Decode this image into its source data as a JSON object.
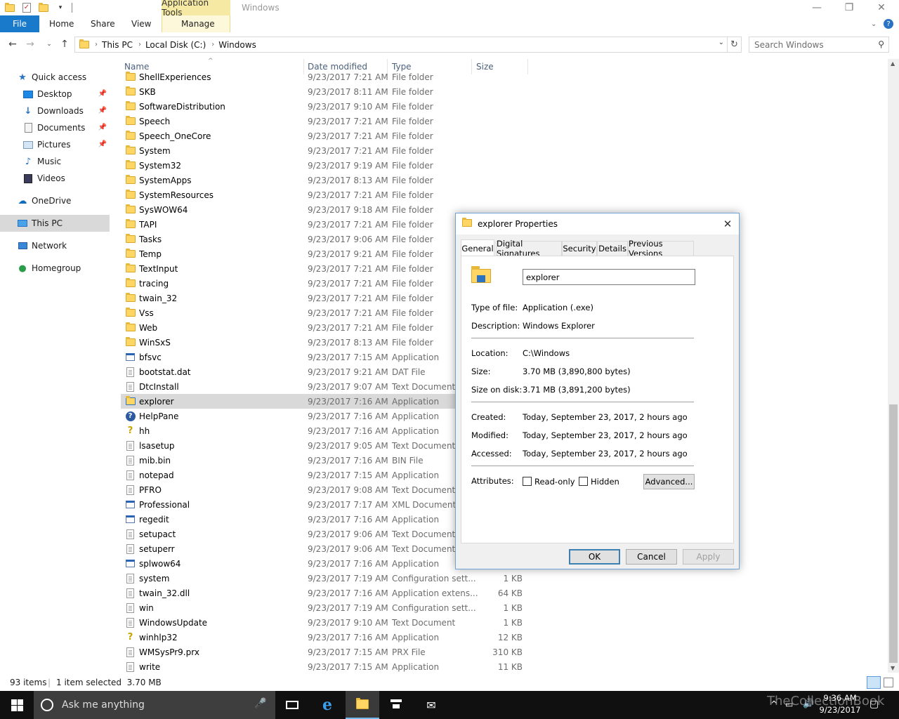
{
  "window": {
    "context_tab": "Application Tools",
    "title": "Windows",
    "controls": {
      "minimize": "—",
      "restore": "❐",
      "close": "✕"
    }
  },
  "ribbon": {
    "file": "File",
    "tabs": [
      "Home",
      "Share",
      "View"
    ],
    "manage": "Manage"
  },
  "address": {
    "segments": [
      "This PC",
      "Local Disk (C:)",
      "Windows"
    ],
    "search_placeholder": "Search Windows"
  },
  "nav": {
    "items": [
      {
        "label": "Quick access",
        "icon": "star-icon"
      },
      {
        "label": "Desktop",
        "icon": "desktop-icon",
        "pinned": true
      },
      {
        "label": "Downloads",
        "icon": "download-icon",
        "pinned": true
      },
      {
        "label": "Documents",
        "icon": "documents-icon",
        "pinned": true
      },
      {
        "label": "Pictures",
        "icon": "pictures-icon",
        "pinned": true
      },
      {
        "label": "Music",
        "icon": "music-icon"
      },
      {
        "label": "Videos",
        "icon": "videos-icon"
      },
      {
        "label": "OneDrive",
        "icon": "cloud-icon"
      },
      {
        "label": "This PC",
        "icon": "computer-icon",
        "selected": true
      },
      {
        "label": "Network",
        "icon": "network-icon"
      },
      {
        "label": "Homegroup",
        "icon": "homegroup-icon"
      }
    ]
  },
  "columns": {
    "name": "Name",
    "date": "Date modified",
    "type": "Type",
    "size": "Size"
  },
  "files": [
    {
      "name": "ShellExperiences",
      "date": "9/23/2017 7:21 AM",
      "type": "File folder",
      "size": "",
      "icon": "folder"
    },
    {
      "name": "SKB",
      "date": "9/23/2017 8:11 AM",
      "type": "File folder",
      "size": "",
      "icon": "folder"
    },
    {
      "name": "SoftwareDistribution",
      "date": "9/23/2017 9:10 AM",
      "type": "File folder",
      "size": "",
      "icon": "folder"
    },
    {
      "name": "Speech",
      "date": "9/23/2017 7:21 AM",
      "type": "File folder",
      "size": "",
      "icon": "folder"
    },
    {
      "name": "Speech_OneCore",
      "date": "9/23/2017 7:21 AM",
      "type": "File folder",
      "size": "",
      "icon": "folder"
    },
    {
      "name": "System",
      "date": "9/23/2017 7:21 AM",
      "type": "File folder",
      "size": "",
      "icon": "folder"
    },
    {
      "name": "System32",
      "date": "9/23/2017 9:19 AM",
      "type": "File folder",
      "size": "",
      "icon": "folder"
    },
    {
      "name": "SystemApps",
      "date": "9/23/2017 8:13 AM",
      "type": "File folder",
      "size": "",
      "icon": "folder"
    },
    {
      "name": "SystemResources",
      "date": "9/23/2017 7:21 AM",
      "type": "File folder",
      "size": "",
      "icon": "folder"
    },
    {
      "name": "SysWOW64",
      "date": "9/23/2017 9:18 AM",
      "type": "File folder",
      "size": "",
      "icon": "folder"
    },
    {
      "name": "TAPI",
      "date": "9/23/2017 7:21 AM",
      "type": "File folder",
      "size": "",
      "icon": "folder"
    },
    {
      "name": "Tasks",
      "date": "9/23/2017 9:06 AM",
      "type": "File folder",
      "size": "",
      "icon": "folder"
    },
    {
      "name": "Temp",
      "date": "9/23/2017 9:21 AM",
      "type": "File folder",
      "size": "",
      "icon": "folder"
    },
    {
      "name": "TextInput",
      "date": "9/23/2017 7:21 AM",
      "type": "File folder",
      "size": "",
      "icon": "folder"
    },
    {
      "name": "tracing",
      "date": "9/23/2017 7:21 AM",
      "type": "File folder",
      "size": "",
      "icon": "folder"
    },
    {
      "name": "twain_32",
      "date": "9/23/2017 7:21 AM",
      "type": "File folder",
      "size": "",
      "icon": "folder"
    },
    {
      "name": "Vss",
      "date": "9/23/2017 7:21 AM",
      "type": "File folder",
      "size": "",
      "icon": "folder"
    },
    {
      "name": "Web",
      "date": "9/23/2017 7:21 AM",
      "type": "File folder",
      "size": "",
      "icon": "folder"
    },
    {
      "name": "WinSxS",
      "date": "9/23/2017 8:13 AM",
      "type": "File folder",
      "size": "",
      "icon": "folder"
    },
    {
      "name": "bfsvc",
      "date": "9/23/2017 7:15 AM",
      "type": "Application",
      "size": "",
      "icon": "app"
    },
    {
      "name": "bootstat.dat",
      "date": "9/23/2017 9:21 AM",
      "type": "DAT File",
      "size": "",
      "icon": "file"
    },
    {
      "name": "DtcInstall",
      "date": "9/23/2017 9:07 AM",
      "type": "Text Document",
      "size": "",
      "icon": "file"
    },
    {
      "name": "explorer",
      "date": "9/23/2017 7:16 AM",
      "type": "Application",
      "size": "",
      "icon": "explorer",
      "selected": true
    },
    {
      "name": "HelpPane",
      "date": "9/23/2017 7:16 AM",
      "type": "Application",
      "size": "",
      "icon": "help"
    },
    {
      "name": "hh",
      "date": "9/23/2017 7:16 AM",
      "type": "Application",
      "size": "",
      "icon": "question"
    },
    {
      "name": "lsasetup",
      "date": "9/23/2017 9:05 AM",
      "type": "Text Document",
      "size": "",
      "icon": "file"
    },
    {
      "name": "mib.bin",
      "date": "9/23/2017 7:16 AM",
      "type": "BIN File",
      "size": "",
      "icon": "file"
    },
    {
      "name": "notepad",
      "date": "9/23/2017 7:15 AM",
      "type": "Application",
      "size": "",
      "icon": "file"
    },
    {
      "name": "PFRO",
      "date": "9/23/2017 9:08 AM",
      "type": "Text Document",
      "size": "",
      "icon": "file"
    },
    {
      "name": "Professional",
      "date": "9/23/2017 7:17 AM",
      "type": "XML Document",
      "size": "",
      "icon": "app"
    },
    {
      "name": "regedit",
      "date": "9/23/2017 7:16 AM",
      "type": "Application",
      "size": "",
      "icon": "app"
    },
    {
      "name": "setupact",
      "date": "9/23/2017 9:06 AM",
      "type": "Text Document",
      "size": "",
      "icon": "file"
    },
    {
      "name": "setuperr",
      "date": "9/23/2017 9:06 AM",
      "type": "Text Document",
      "size": "",
      "icon": "file"
    },
    {
      "name": "splwow64",
      "date": "9/23/2017 7:16 AM",
      "type": "Application",
      "size": "",
      "icon": "app"
    },
    {
      "name": "system",
      "date": "9/23/2017 7:19 AM",
      "type": "Configuration sett...",
      "size": "1 KB",
      "icon": "file"
    },
    {
      "name": "twain_32.dll",
      "date": "9/23/2017 7:16 AM",
      "type": "Application extens...",
      "size": "64 KB",
      "icon": "file"
    },
    {
      "name": "win",
      "date": "9/23/2017 7:19 AM",
      "type": "Configuration sett...",
      "size": "1 KB",
      "icon": "file"
    },
    {
      "name": "WindowsUpdate",
      "date": "9/23/2017 9:10 AM",
      "type": "Text Document",
      "size": "1 KB",
      "icon": "file"
    },
    {
      "name": "winhlp32",
      "date": "9/23/2017 7:16 AM",
      "type": "Application",
      "size": "12 KB",
      "icon": "question"
    },
    {
      "name": "WMSysPr9.prx",
      "date": "9/23/2017 7:15 AM",
      "type": "PRX File",
      "size": "310 KB",
      "icon": "file"
    },
    {
      "name": "write",
      "date": "9/23/2017 7:15 AM",
      "type": "Application",
      "size": "11 KB",
      "icon": "file"
    }
  ],
  "status": {
    "count": "93 items",
    "selection": "1 item selected  3.70 MB"
  },
  "dialog": {
    "title": "explorer Properties",
    "tabs": [
      "General",
      "Digital Signatures",
      "Security",
      "Details",
      "Previous Versions"
    ],
    "name_value": "explorer",
    "props": {
      "type_label": "Type of file:",
      "type_value": "Application (.exe)",
      "desc_label": "Description:",
      "desc_value": "Windows Explorer",
      "loc_label": "Location:",
      "loc_value": "C:\\Windows",
      "size_label": "Size:",
      "size_value": "3.70 MB (3,890,800 bytes)",
      "disk_label": "Size on disk:",
      "disk_value": "3.71 MB (3,891,200 bytes)",
      "created_label": "Created:",
      "created_value": "Today, September 23, 2017, 2 hours ago",
      "modified_label": "Modified:",
      "modified_value": "Today, September 23, 2017, 2 hours ago",
      "accessed_label": "Accessed:",
      "accessed_value": "Today, September 23, 2017, 2 hours ago",
      "attr_label": "Attributes:",
      "readonly": "Read-only",
      "hidden": "Hidden",
      "advanced": "Advanced..."
    },
    "buttons": {
      "ok": "OK",
      "cancel": "Cancel",
      "apply": "Apply"
    }
  },
  "taskbar": {
    "search": "Ask me anything",
    "time": "9:36 AM",
    "date": "9/23/2017",
    "watermark": "TheCollectionBook"
  },
  "colors": {
    "accent": "#1979ca",
    "selection": "#d9d9d9",
    "context_tab": "#f6e9a3"
  }
}
